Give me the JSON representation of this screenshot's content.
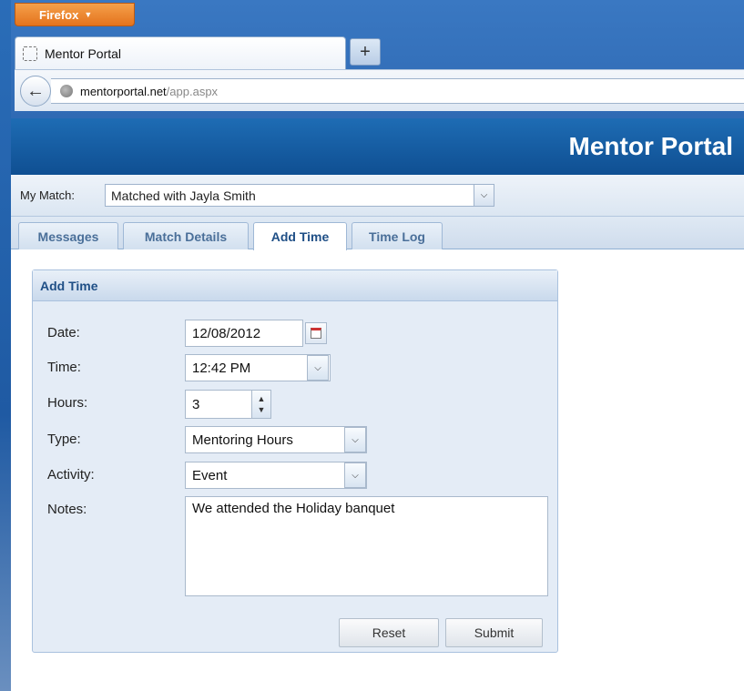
{
  "browser": {
    "menu_label": "Firefox",
    "tab_title": "Mentor Portal",
    "new_tab_label": "+",
    "url_host": "mentorportal.net",
    "url_path": "/app.aspx"
  },
  "app": {
    "title": "Mentor Portal"
  },
  "match": {
    "label": "My Match:",
    "selected": "Matched with Jayla Smith"
  },
  "tabs": [
    {
      "label": "Messages"
    },
    {
      "label": "Match Details"
    },
    {
      "label": "Add Time",
      "active": true
    },
    {
      "label": "Time Log"
    }
  ],
  "panel": {
    "title": "Add Time",
    "fields": {
      "date": {
        "label": "Date:",
        "value": "12/08/2012"
      },
      "time": {
        "label": "Time:",
        "value": "12:42 PM"
      },
      "hours": {
        "label": "Hours:",
        "value": "3"
      },
      "type": {
        "label": "Type:",
        "value": "Mentoring Hours"
      },
      "activity": {
        "label": "Activity:",
        "value": "Event"
      },
      "notes": {
        "label": "Notes:",
        "value": "We attended the Holiday banquet"
      }
    },
    "reset_label": "Reset",
    "submit_label": "Submit"
  },
  "icons": {
    "dropdown": "chevron-down-icon",
    "calendar": "calendar-icon",
    "back": "back-arrow-icon",
    "site": "globe-icon",
    "spinner": "spinner-icon"
  },
  "colors": {
    "header_blue": "#1e6cb4",
    "firefox_orange": "#e4731d",
    "tab_text": "#4a6f99",
    "panel_bg": "#e4ecf6"
  }
}
